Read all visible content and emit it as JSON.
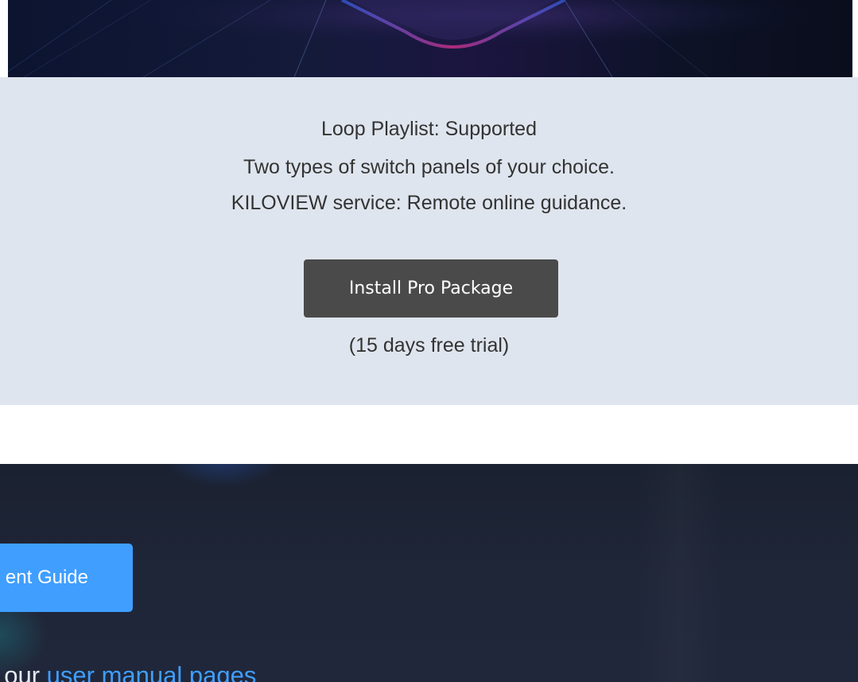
{
  "info": {
    "line1": "Loop Playlist: Supported",
    "line2": "Two types of switch panels of your choice.",
    "line3": "KILOVIEW service: Remote online guidance.",
    "install_button": "Install Pro Package",
    "trial_note": "(15 days free trial)"
  },
  "guide": {
    "button_label": "ent Guide",
    "manual_prefix": "t our ",
    "manual_link": "user manual pages"
  },
  "colors": {
    "panel_bg": "#dfe5ee",
    "install_button_bg": "#4a4a4a",
    "accent_blue": "#409eff",
    "dark_section_bg": "#1f2638"
  }
}
